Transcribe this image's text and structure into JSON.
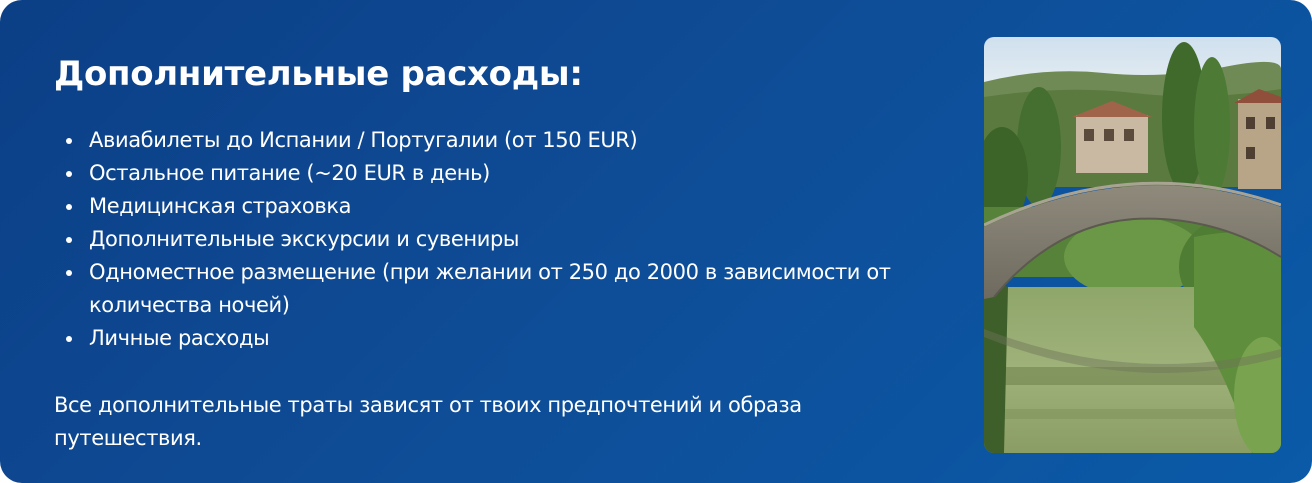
{
  "card": {
    "title": "Дополнительные расходы:",
    "items": [
      "Авиабилеты до Испании / Португалии (от 150 EUR)",
      "Остальное питание (~20 EUR в день)",
      "Медицинская страховка",
      "Дополнительные экскурсии и сувениры",
      "Одноместное размещение (при желании от 250 до 2000 в зависимости от количества ночей)",
      "Личные расходы"
    ],
    "footer": "Все дополнительные траты зависят от твоих предпочтений и образа путешествия."
  },
  "colors": {
    "background_start": "#0b3f86",
    "background_end": "#0a5aa8",
    "text": "#ffffff"
  },
  "photo": {
    "subject": "stone-bridge-over-river-photo"
  }
}
